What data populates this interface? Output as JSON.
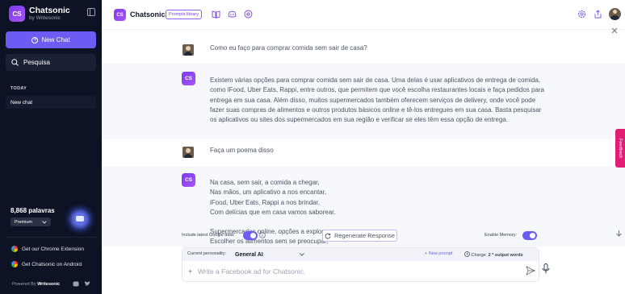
{
  "sidebar": {
    "logo_text": "CS",
    "brand": "Chatsonic",
    "brand_sub": "by Writesonic",
    "new_chat": "New Chat",
    "search": "Pesquisa",
    "history_heading": "TODAY",
    "history": [
      "New chat"
    ],
    "words": "8,868 palavras",
    "plan": "Premium",
    "chrome_ext": "Get our Chrome Extension",
    "android": "Get Chatsonic on Android",
    "powered_prefix": "Powered By",
    "powered_brand": "Writesonic"
  },
  "header": {
    "logo_text": "CS",
    "title": "Chatsonic",
    "prompts_library": "Prompts library"
  },
  "messages": [
    {
      "role": "user",
      "text": "Como eu faço para comprar comida sem sair de casa?"
    },
    {
      "role": "bot",
      "avatar": "CS",
      "text": "Existem várias opções para comprar comida sem sair de casa. Uma delas é usar aplicativos de entrega de comida, como iFood, Uber Eats, Rappi, entre outros, que permitem que você escolha restaurantes locais e faça pedidos para entrega em sua casa. Além disso, muitos supermercados também oferecem serviços de delivery, onde você pode fazer suas compras de alimentos e outros produtos básicos online e tê-los entregues em sua casa. Basta pesquisar os aplicativos ou sites dos supermercados em sua região e verificar se eles têm essa opção de entrega."
    },
    {
      "role": "user",
      "text": "Faça um poema disso"
    },
    {
      "role": "bot",
      "avatar": "CS",
      "lines": [
        "Na casa, sem sair, a comida a chegar,",
        "Nas mãos, um aplicativo a nos encantar,",
        "iFood, Uber Eats, Rappi a nos brindar,",
        "Com delícias que em casa vamos saborear.",
        "",
        "Supermercados online, opções a explorar,",
        "Escolher os alimentos sem se preocupar,"
      ]
    }
  ],
  "controls": {
    "google_label": "Include latest Google data:",
    "regenerate": "Regenerate Response",
    "memory_label": "Enable Memory:",
    "google_on": true,
    "memory_on": true
  },
  "composer": {
    "personality_label": "Current personality:",
    "personality_value": "General AI",
    "new_prompt": "+ New prompt",
    "charge_label": "Charge:",
    "charge_value": "2 * output words",
    "placeholder": "Write a Facebook ad for Chatsonic."
  },
  "feedback": "Feedback",
  "colors": {
    "accent": "#6d5cf3",
    "sidebar": "#0d1224",
    "feedback": "#e11d74"
  }
}
